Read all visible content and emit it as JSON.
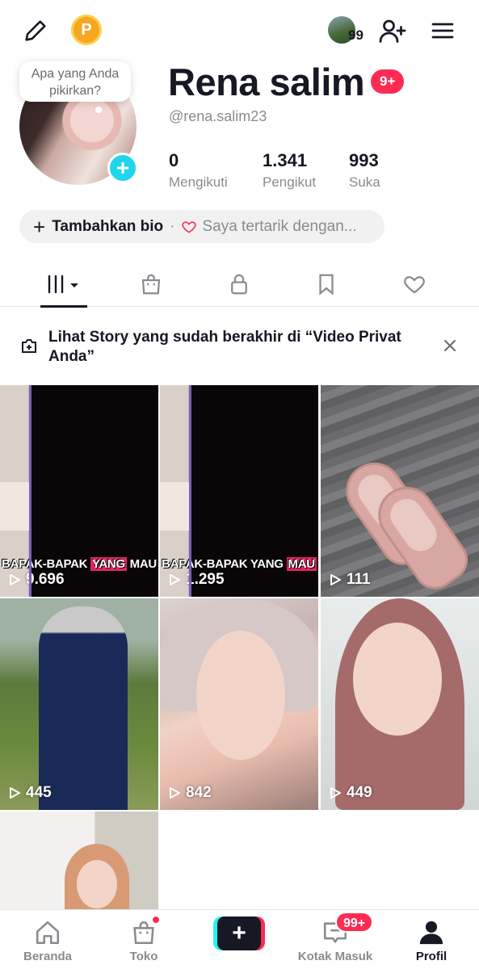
{
  "topbar": {
    "edit_icon": "pencil-icon",
    "coin_icon": "coin-icon",
    "coin_letter": "P",
    "visitors_count": "99",
    "add_user_icon": "add-user-icon",
    "menu_icon": "hamburger-menu-icon"
  },
  "profile": {
    "bubble_text": "Apa yang Anda pikirkan?",
    "name": "Rena salim",
    "notification_badge": "9+",
    "handle": "@rena.salim23",
    "stats": [
      {
        "value": "0",
        "label": "Mengikuti"
      },
      {
        "value": "1.341",
        "label": "Pengikut"
      },
      {
        "value": "993",
        "label": "Suka"
      }
    ],
    "bio_add_label": "Tambahkan bio",
    "bio_separator": "·",
    "interest_label": "Saya tertarik dengan..."
  },
  "tabs": [
    {
      "icon": "videos-grid-icon",
      "active": true
    },
    {
      "icon": "shop-bag-icon",
      "active": false
    },
    {
      "icon": "lock-icon",
      "active": false
    },
    {
      "icon": "bookmark-icon",
      "active": false
    },
    {
      "icon": "heart-icon",
      "active": false
    }
  ],
  "story_banner": {
    "text": "Lihat Story yang sudah berakhir di “Video Privat Anda”",
    "close_icon": "close-icon"
  },
  "videos": [
    {
      "views": "9.696",
      "caption_pre": "BAPAK-BAPAK ",
      "caption_hl": "YANG",
      "caption_post": " MAU"
    },
    {
      "views": "1.295",
      "caption_pre": "BAPAK-BAPAK YANG ",
      "caption_hl": "MAU",
      "caption_post": ""
    },
    {
      "views": "111"
    },
    {
      "views": "445"
    },
    {
      "views": "842"
    },
    {
      "views": "449"
    },
    {
      "views": ""
    }
  ],
  "bottom_nav": {
    "home": "Beranda",
    "shop": "Toko",
    "inbox": "Kotak Masuk",
    "inbox_badge": "99+",
    "profile": "Profil"
  },
  "colors": {
    "accent_red": "#fe2c55",
    "accent_cyan": "#25f4ee",
    "text": "#161823",
    "muted": "#8a8b91"
  }
}
